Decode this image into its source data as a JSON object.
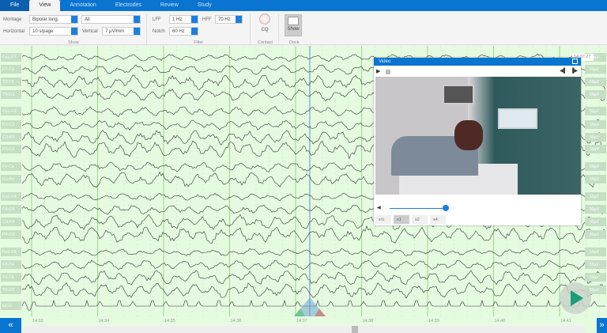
{
  "tabs": [
    {
      "label": "File"
    },
    {
      "label": "View"
    },
    {
      "label": "Annotation"
    },
    {
      "label": "Electrodes"
    },
    {
      "label": "Review"
    },
    {
      "label": "Study"
    }
  ],
  "ribbon": {
    "montage_label": "Montage",
    "montage_value": "Bipolar long.",
    "channels_value": "All",
    "horizontal_label": "Horizontal",
    "horizontal_value": "10 s/page",
    "vertical_label": "Vertical",
    "vertical_value": "7 µV/mm",
    "show_group": "Show",
    "lff_label": "LFF",
    "lff_value": "1 Hz",
    "hff_label": "HFF",
    "hff_value": "70 Hz",
    "notch_label": "Notch",
    "notch_value": "60 Hz",
    "filter_group": "Filter",
    "cq_label": "CQ",
    "contact_group": "Contact",
    "show_button": "Show",
    "dock_group": "Dock"
  },
  "channels": [
    "Fp1-F7",
    "F7-T3",
    "T3-T5",
    "T5-O1",
    "Fp1-F3",
    "F3-C3",
    "C3-P3",
    "P3-O1",
    "Fz-Cz",
    "Cz-Pz",
    "Fp2-F4",
    "F4-C4",
    "C4-P4",
    "P4-O2",
    "Fp2-F8",
    "F8-T4",
    "T4-T6",
    "T6-O2",
    "ECG"
  ],
  "scale_label": "50µV",
  "time_display": "14:37:27",
  "video": {
    "title": "Video",
    "speeds": [
      "x½",
      "x1",
      "x2",
      "x4"
    ],
    "selected_speed": "x1",
    "volume": 1.0
  },
  "time_ticks": [
    "14:33",
    "14:34",
    "14:35",
    "14:36",
    "14:37",
    "14:38",
    "14:39",
    "14:40",
    "14:41"
  ],
  "colors": {
    "accent": "#0a74d1",
    "plot_bg": "#e4fbe0",
    "play": "#1b9e77"
  }
}
